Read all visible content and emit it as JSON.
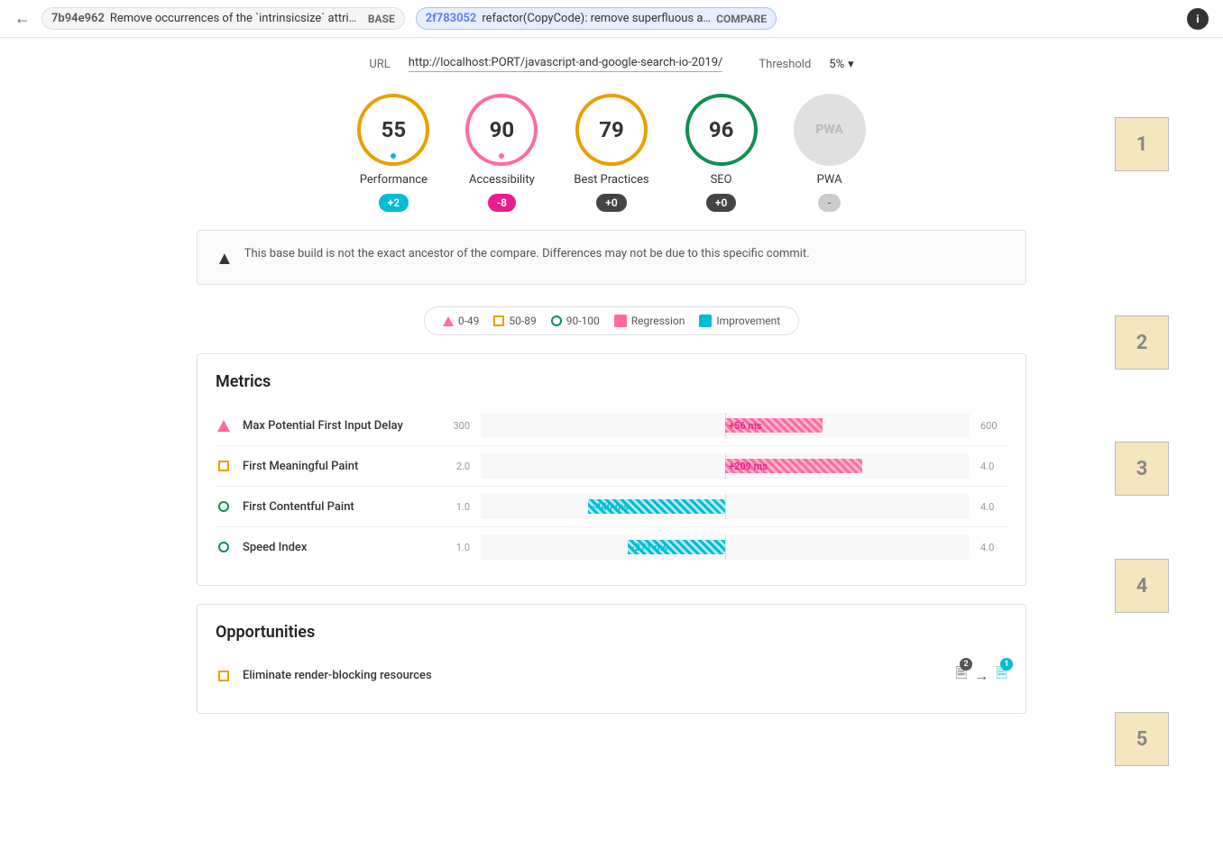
{
  "topbar": {
    "back_icon": "←",
    "base_hash": "7b94e962",
    "base_msg": "Remove occurrences of the `intrinsicsize` attrib…",
    "base_label": "BASE",
    "compare_hash": "2f783052",
    "compare_msg": "refactor(CopyCode): remove superfluous a…",
    "compare_label": "COMPARE",
    "info_icon": "i"
  },
  "url_row": {
    "url_label": "URL",
    "url_value": "http://localhost:PORT/javascript-and-google-search-io-2019/",
    "threshold_label": "Threshold",
    "threshold_value": "5%",
    "threshold_icon": "▾"
  },
  "scores": [
    {
      "id": "performance",
      "value": "55",
      "label": "Performance",
      "badge": "+2",
      "badge_type": "teal",
      "circle_type": "orange",
      "indicator_color": "teal"
    },
    {
      "id": "accessibility",
      "value": "90",
      "label": "Accessibility",
      "badge": "-8",
      "badge_type": "pink",
      "circle_type": "pink",
      "indicator_color": "pink"
    },
    {
      "id": "best-practices",
      "value": "79",
      "label": "Best Practices",
      "badge": "+0",
      "badge_type": "dark",
      "circle_type": "orange2"
    },
    {
      "id": "seo",
      "value": "96",
      "label": "SEO",
      "badge": "+0",
      "badge_type": "dark",
      "circle_type": "green"
    },
    {
      "id": "pwa",
      "value": "PWA",
      "label": "PWA",
      "badge": "-",
      "badge_type": "gray",
      "circle_type": "pwa"
    }
  ],
  "warning": {
    "icon": "▲",
    "text": "This base build is not the exact ancestor of the compare. Differences may not be due to this specific commit."
  },
  "legend": {
    "items": [
      {
        "id": "range-0-49",
        "type": "triangle",
        "label": "0-49"
      },
      {
        "id": "range-50-89",
        "type": "square-orange",
        "label": "50-89"
      },
      {
        "id": "range-90-100",
        "type": "circle-green",
        "label": "90-100"
      },
      {
        "id": "regression",
        "type": "reg",
        "label": "Regression"
      },
      {
        "id": "improvement",
        "type": "imp",
        "label": "Improvement"
      }
    ]
  },
  "metrics": {
    "title": "Metrics",
    "rows": [
      {
        "id": "max-potential-fid",
        "icon_type": "triangle",
        "name": "Max Potential First Input Delay",
        "scale_start": "300",
        "scale_end": "600",
        "bar_type": "pink",
        "bar_label": "+56 ms",
        "bar_offset_pct": 50,
        "bar_width_pct": 20
      },
      {
        "id": "first-meaningful-paint",
        "icon_type": "square-orange",
        "name": "First Meaningful Paint",
        "scale_start": "2.0",
        "scale_end": "4.0",
        "bar_type": "pink",
        "bar_label": "+209 ms",
        "bar_offset_pct": 50,
        "bar_width_pct": 28
      },
      {
        "id": "first-contentful-paint",
        "icon_type": "circle-green",
        "name": "First Contentful Paint",
        "scale_start": "1.0",
        "scale_end": "4.0",
        "bar_type": "teal",
        "bar_label": "-440 ms",
        "bar_offset_pct": 22,
        "bar_width_pct": 28
      },
      {
        "id": "speed-index",
        "icon_type": "circle-green",
        "name": "Speed Index",
        "scale_start": "1.0",
        "scale_end": "4.0",
        "bar_type": "teal",
        "bar_label": "-271 ms",
        "bar_offset_pct": 30,
        "bar_width_pct": 20
      }
    ]
  },
  "opportunities": {
    "title": "Opportunities",
    "rows": [
      {
        "id": "eliminate-render-blocking",
        "icon_type": "square-orange",
        "name": "Eliminate render-blocking resources",
        "badge_count": "2"
      }
    ]
  },
  "annotations": {
    "labels": [
      "1",
      "2",
      "3",
      "4",
      "5"
    ]
  }
}
